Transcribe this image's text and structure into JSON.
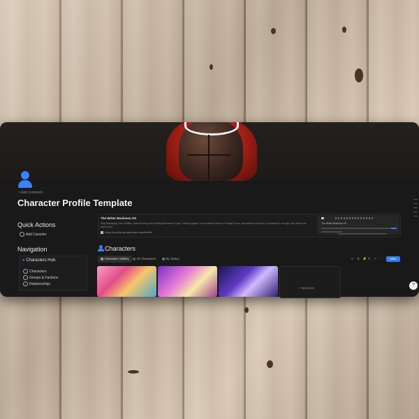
{
  "page": {
    "add_comment": "Add comment",
    "title": "Character Profile Template"
  },
  "quick_actions": {
    "heading": "Quick Actions",
    "items": [
      {
        "label": "Add Caracter",
        "icon": "person-add-icon"
      }
    ]
  },
  "navigation": {
    "heading": "Navigation",
    "hub_label": "Characters Hub",
    "items": [
      {
        "label": "Characters",
        "icon": "person-icon"
      },
      {
        "label": "Groups & Factions",
        "icon": "group-icon"
      },
      {
        "label": "Relationships",
        "icon": "people-icon"
      }
    ]
  },
  "info_callout": {
    "title": "The Writer Business OS",
    "description": "Stop Managing Your Writing. Start Running Your Writing Business If your \"writing system\" is a scattered mess of Google Docs, spreadsheet invoices, a separate to-do app, and client info lost in your...",
    "url": "https://yourhouse.gumroad.com/l/nhfiv",
    "preview_title": "The Writer Business OS"
  },
  "characters": {
    "heading": "Characters",
    "tabs": [
      {
        "label": "Character Gallery",
        "icon": "gallery-icon",
        "active": true
      },
      {
        "label": "All Characters",
        "icon": "table-icon",
        "active": false
      },
      {
        "label": "By Status",
        "icon": "board-icon",
        "active": false
      }
    ],
    "new_button": "New",
    "new_item": "+ New item",
    "help": "?"
  },
  "colors": {
    "accent": "#2f80ed",
    "background": "#191919",
    "text": "#eaeaea"
  }
}
